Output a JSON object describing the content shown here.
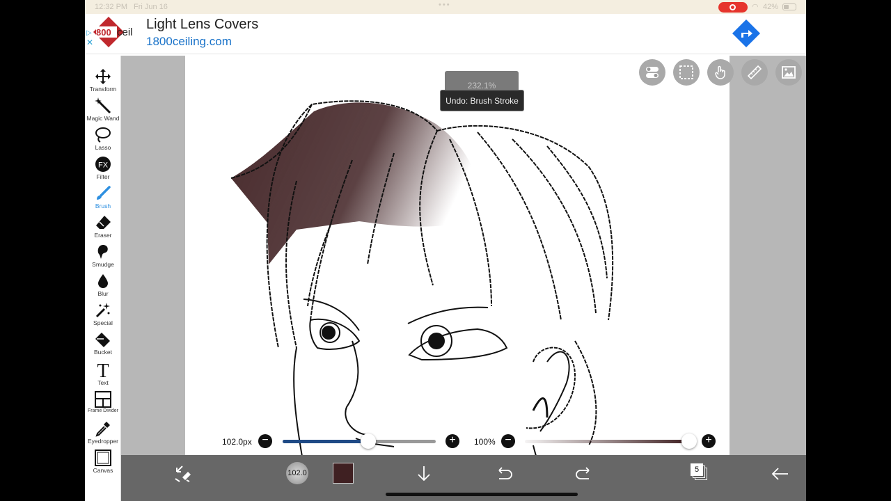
{
  "status_bar": {
    "time": "12:32 PM",
    "date": "Fri Jun 16",
    "battery": "42%"
  },
  "ad": {
    "brand_logo_text": "800ceil",
    "headline": "Light Lens Covers",
    "url": "1800ceiling.com"
  },
  "toolbar": {
    "tools": [
      {
        "label": "Transform",
        "icon": "move-arrows-icon"
      },
      {
        "label": "Magic Wand",
        "icon": "magic-wand-icon"
      },
      {
        "label": "Lasso",
        "icon": "lasso-icon"
      },
      {
        "label": "Filter",
        "icon": "fx-filter-icon"
      },
      {
        "label": "Brush",
        "icon": "brush-icon"
      },
      {
        "label": "Eraser",
        "icon": "eraser-icon"
      },
      {
        "label": "Smudge",
        "icon": "smudge-icon"
      },
      {
        "label": "Blur",
        "icon": "blur-drop-icon"
      },
      {
        "label": "Special",
        "icon": "special-sparkle-icon"
      },
      {
        "label": "Bucket",
        "icon": "bucket-icon"
      },
      {
        "label": "Text",
        "icon": "text-icon"
      },
      {
        "label": "Frame Divider",
        "icon": "frame-divider-icon"
      },
      {
        "label": "Eyedropper",
        "icon": "eyedropper-icon"
      },
      {
        "label": "Canvas",
        "icon": "canvas-icon"
      }
    ],
    "active": "Brush",
    "accent": "#2d8fe0"
  },
  "canvas": {
    "zoom": "232.1%",
    "tooltip": "Undo: Brush Stroke"
  },
  "brush": {
    "size_label": "102.0px",
    "size_fraction": 0.56,
    "opacity_label": "100%",
    "opacity_fraction": 1.0,
    "size_badge": "102.0"
  },
  "colors": {
    "current": "#3f2022",
    "slider_fill": "#1f4a86"
  },
  "layers": {
    "count": "5"
  }
}
